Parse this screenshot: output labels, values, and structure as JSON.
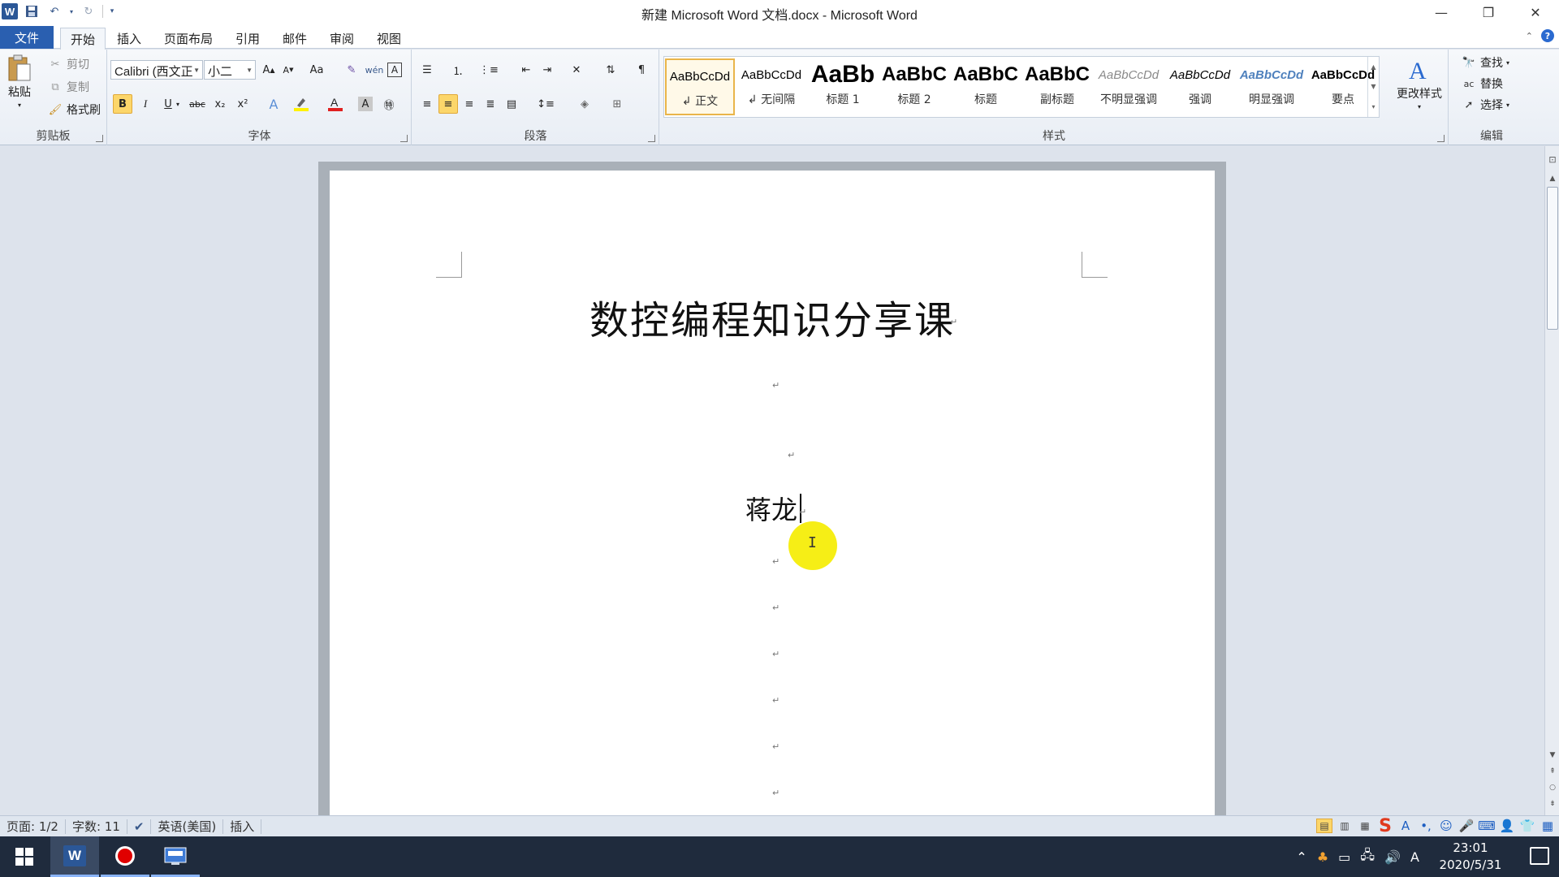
{
  "window": {
    "title": "新建 Microsoft Word 文档.docx - Microsoft Word",
    "qat": {
      "logo": "W",
      "save_icon": "save-icon",
      "undo_icon": "undo-icon",
      "redo_icon": "redo-icon",
      "customize_icon": "customize-qat-icon"
    },
    "controls": {
      "minimize": "—",
      "restore": "❐",
      "close": "✕"
    }
  },
  "tabs": {
    "file": "文件",
    "items": [
      "开始",
      "插入",
      "页面布局",
      "引用",
      "邮件",
      "审阅",
      "视图"
    ],
    "active": "开始"
  },
  "ribbon": {
    "clipboard": {
      "label": "剪贴板",
      "paste": "粘贴",
      "cut": "剪切",
      "copy": "复制",
      "format_painter": "格式刷"
    },
    "font": {
      "label": "字体",
      "font_name": "Calibri (西文正",
      "font_size": "小二",
      "bold": "B",
      "italic": "I",
      "underline": "U",
      "strike": "abc",
      "subscript": "x₂",
      "superscript": "x²",
      "case": "Aa"
    },
    "paragraph": {
      "label": "段落"
    },
    "styles": {
      "label": "样式",
      "items": [
        {
          "preview": "AaBbCcDd",
          "name": "↲ 正文"
        },
        {
          "preview": "AaBbCcDd",
          "name": "↲ 无间隔"
        },
        {
          "preview": "AaBb",
          "name": "标题 1"
        },
        {
          "preview": "AaBbC",
          "name": "标题 2"
        },
        {
          "preview": "AaBbC",
          "name": "标题"
        },
        {
          "preview": "AaBbC",
          "name": "副标题"
        },
        {
          "preview": "AaBbCcDd",
          "name": "不明显强调"
        },
        {
          "preview": "AaBbCcDd",
          "name": "强调"
        },
        {
          "preview": "AaBbCcDd",
          "name": "明显强调"
        },
        {
          "preview": "AaBbCcDd",
          "name": "要点"
        }
      ],
      "change_styles": "更改样式"
    },
    "editing": {
      "label": "编辑",
      "find": "查找",
      "replace": "替换",
      "select": "选择"
    }
  },
  "document": {
    "title": "数控编程知识分享课",
    "author": "蒋龙",
    "paragraph_mark": "↵"
  },
  "statusbar": {
    "page": "页面: 1/2",
    "words": "字数: 11",
    "language": "英语(美国)",
    "mode": "插入"
  },
  "taskbar": {
    "time": "23:01",
    "date": "2020/5/31",
    "ime_indicator": "A"
  },
  "colors": {
    "accent": "#2a5fb0",
    "highlight_cursor": "#f6ee16",
    "active_button": "#fcd66a"
  }
}
